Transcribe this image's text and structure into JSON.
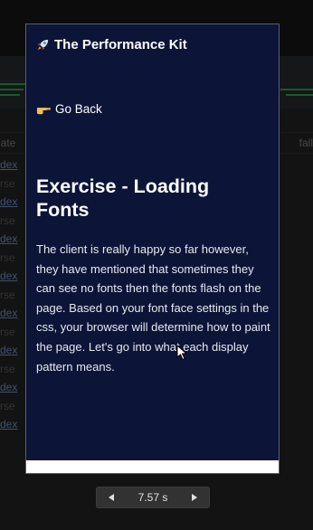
{
  "background": {
    "header_left": "iate",
    "header_right": "fall",
    "rows": [
      "dex",
      "rse",
      "dex",
      "rse",
      "dex",
      "rse",
      "dex",
      "rse",
      "dex",
      "rse",
      "dex",
      "rse",
      "dex",
      "rse",
      "dex"
    ]
  },
  "page": {
    "brand": "The Performance Kit",
    "brand_icon": "rocket-icon",
    "back_label": "Go Back",
    "back_icon": "pointing-hand-icon",
    "title": "Exercise - Loading Fonts",
    "body": "The client is really happy so far however, they have mentioned that sometimes they can see no fonts then the fonts flash on the page. Based on your font face settings in the css, your browser will determine how to paint the page. Let's go into what each display pattern means."
  },
  "playback": {
    "time": "7.57 s",
    "prev_icon": "triangle-left-icon",
    "next_icon": "triangle-right-icon"
  },
  "colors": {
    "page_bg": "#0c1537",
    "accent_green": "#3cc35a",
    "link_blue": "#8ab4f8"
  }
}
